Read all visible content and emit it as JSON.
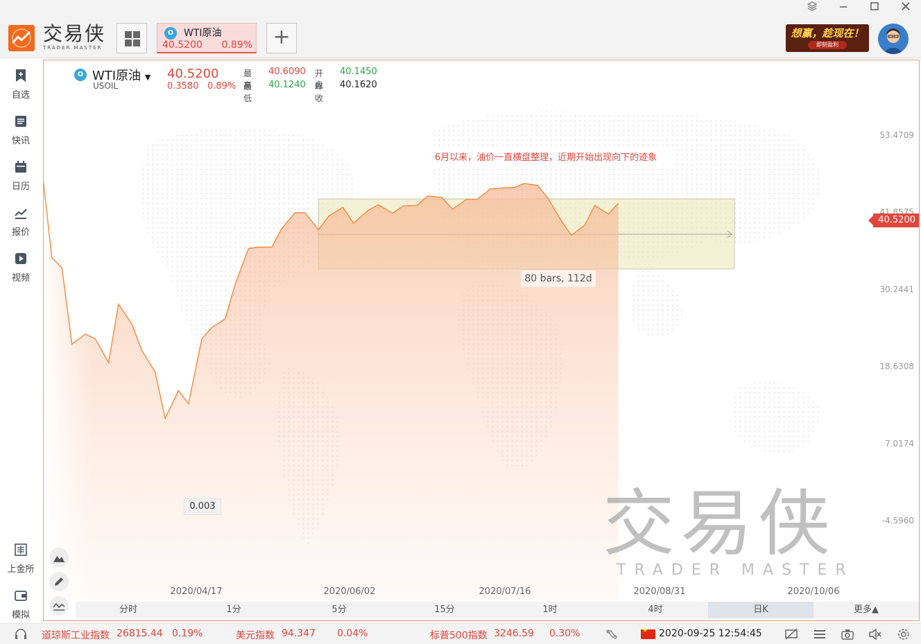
{
  "app": {
    "brand_cn": "交易侠",
    "brand_en": "TRADER MASTER"
  },
  "tab": {
    "name": "WTI原油",
    "price": "40.5200",
    "change_pct": "0.89%",
    "icon_letter": "O"
  },
  "ad": {
    "main": "想赢，趁现在！",
    "sub": "即刻盈利"
  },
  "sidebar": {
    "items": [
      {
        "label": "自选",
        "icon": "bookmark-plus-icon"
      },
      {
        "label": "快讯",
        "icon": "news-list-icon"
      },
      {
        "label": "日历",
        "icon": "calendar-icon"
      },
      {
        "label": "报价",
        "icon": "trend-line-icon"
      },
      {
        "label": "视频",
        "icon": "play-icon"
      },
      {
        "label": "上金所",
        "icon": "exchange-icon"
      },
      {
        "label": "模拟",
        "icon": "wallet-icon"
      }
    ]
  },
  "quote": {
    "name": "WTI原油",
    "code": "USOIL",
    "price": "40.5200",
    "change": "0.3580",
    "change_pct": "0.89%",
    "high_label": "最高",
    "high": "40.6090",
    "low_label": "最低",
    "low": "40.1240",
    "open_label": "开盘",
    "open": "40.1450",
    "prev_close_label": "昨收",
    "prev_close": "40.1620"
  },
  "annotation": {
    "note": "6月以来，油价一直横盘整理，近期开始出现向下的迹象",
    "range_label": "80 bars, 112d",
    "low_tip": "0.003",
    "last_price_flag": "40.5200"
  },
  "watermark": {
    "cn": "交易侠",
    "en": "TRADER MASTER"
  },
  "periods": [
    {
      "label": "分时",
      "active": false
    },
    {
      "label": "1分",
      "active": false
    },
    {
      "label": "5分",
      "active": false
    },
    {
      "label": "15分",
      "active": false
    },
    {
      "label": "1时",
      "active": false
    },
    {
      "label": "4时",
      "active": false
    },
    {
      "label": "日K",
      "active": true
    },
    {
      "label": "更多▲",
      "active": false
    }
  ],
  "status": {
    "dow_name": "道琼斯工业指数",
    "dow_value": "26815.44",
    "dow_pct": "0.19%",
    "usd_name": "美元指数",
    "usd_value": "94.347",
    "usd_pct": "0.04%",
    "sp_name": "标普500指数",
    "sp_value": "3246.59",
    "sp_pct": "0.30%",
    "datetime": "2020-09-25 12:54:45"
  },
  "colors": {
    "accent": "#f26a1b",
    "up": "#e0463c",
    "down": "#28a745",
    "line": "#f08a3c"
  },
  "chart_data": {
    "type": "area",
    "y_ticks": [
      "53.4709",
      "41.8575",
      "30.2441",
      "18.6308",
      "7.0174",
      "-4.5960"
    ],
    "x_ticks": [
      "2020/04/17",
      "2020/06/02",
      "2020/07/16",
      "2020/08/31",
      "2020/10/06"
    ],
    "ylim": [
      -10.0,
      62.0
    ],
    "x": [
      "2020/03/09",
      "2020/03/13",
      "2020/03/16",
      "2020/03/19",
      "2020/03/23",
      "2020/03/26",
      "2020/03/30",
      "2020/04/02",
      "2020/04/06",
      "2020/04/09",
      "2020/04/13",
      "2020/04/16",
      "2020/04/20",
      "2020/04/23",
      "2020/04/27",
      "2020/04/30",
      "2020/05/04",
      "2020/05/07",
      "2020/05/11",
      "2020/05/14",
      "2020/05/18",
      "2020/05/21",
      "2020/05/25",
      "2020/05/28",
      "2020/06/01",
      "2020/06/04",
      "2020/06/08",
      "2020/06/11",
      "2020/06/15",
      "2020/06/18",
      "2020/06/22",
      "2020/06/25",
      "2020/06/29",
      "2020/07/02",
      "2020/07/06",
      "2020/07/09",
      "2020/07/13",
      "2020/07/16",
      "2020/07/20",
      "2020/07/23",
      "2020/07/27",
      "2020/07/30",
      "2020/08/03",
      "2020/08/06",
      "2020/08/10",
      "2020/08/13",
      "2020/08/17",
      "2020/08/20",
      "2020/08/24",
      "2020/08/27",
      "2020/08/31",
      "2020/09/03",
      "2020/09/07",
      "2020/09/10",
      "2020/09/14",
      "2020/09/17",
      "2020/09/21",
      "2020/09/24"
    ],
    "values": [
      53.0,
      35.0,
      33.5,
      22.0,
      23.5,
      22.8,
      19.2,
      28.0,
      25.0,
      21.0,
      17.8,
      10.8,
      15.0,
      13.0,
      22.8,
      24.5,
      25.8,
      31.0,
      36.4,
      36.6,
      36.6,
      39.4,
      41.8,
      41.8,
      39.2,
      41.3,
      42.6,
      40.2,
      42.1,
      43.0,
      41.7,
      42.8,
      42.9,
      44.3,
      44.1,
      42.3,
      43.8,
      43.8,
      45.4,
      45.5,
      45.6,
      46.2,
      45.9,
      44.0,
      40.6,
      38.4,
      39.9,
      42.9,
      41.6,
      43.2
    ],
    "range_box": {
      "from": "2020/06/01",
      "to": "2020/09/24",
      "bars": 80,
      "days": 112
    }
  }
}
